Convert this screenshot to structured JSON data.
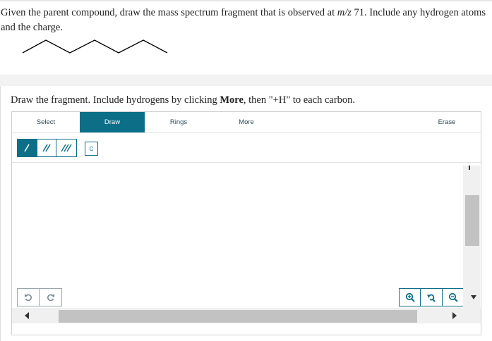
{
  "question": {
    "part1": "Given the parent compound, draw the mass spectrum fragment that is observed at ",
    "mz": "m/z",
    "part2": " 71. Include any hydrogen atoms and the charge."
  },
  "instruction": {
    "part1": "Draw the fragment. Include hydrogens by clicking ",
    "bold": "More",
    "part2": ", then \"+H\" to each carbon."
  },
  "toolbar": {
    "tabs": [
      "Select",
      "Draw",
      "Rings",
      "More",
      "Erase"
    ],
    "active_tab": "Draw"
  },
  "atom_button": "C",
  "colors": {
    "accent": "#0d6e88",
    "border": "#cfcfcf",
    "scroll_thumb": "#c2c2c2"
  },
  "icons": {
    "bonds": [
      "single-bond-icon",
      "double-bond-icon",
      "triple-bond-icon"
    ],
    "undo": [
      "undo-icon",
      "redo-icon"
    ],
    "zoom": [
      "zoom-in-icon",
      "zoom-reset-icon",
      "zoom-out-icon"
    ]
  }
}
